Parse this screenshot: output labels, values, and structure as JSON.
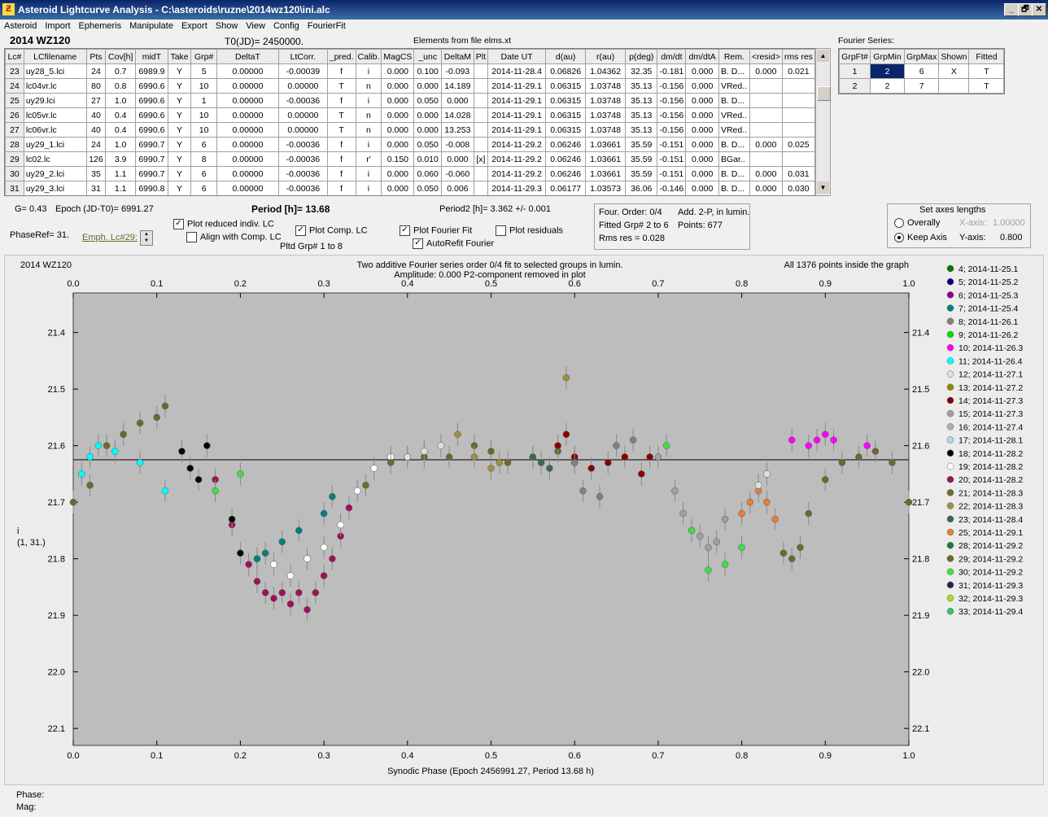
{
  "window": {
    "title": "Asteroid Lightcurve Analysis - C:\\asteroids\\ruzne\\2014wz120\\ini.alc",
    "icon_name": "app-logo-icon",
    "buttons": [
      "_",
      "🗗",
      "✕"
    ]
  },
  "menu": [
    "Asteroid",
    "Import",
    "Ephemeris",
    "Manipulate",
    "Export",
    "Show",
    "View",
    "Config",
    "FourierFit"
  ],
  "header": {
    "asteroid": "2014 WZ120",
    "t0": "T0(JD)= 2450000.",
    "elements": "Elements from file elms.xt"
  },
  "lc_table": {
    "columns": [
      "Lc#",
      "LCfilename",
      "Pts",
      "Cov[h]",
      "midT",
      "Take",
      "Grp#",
      "DeltaT",
      "LtCorr.",
      "_pred.",
      "Calib.",
      "MagCS",
      "_unc",
      "DeltaM",
      "Plt",
      "Date UT",
      "d(au)",
      "r(au)",
      "p(deg)",
      "dm/dt",
      "dm/dtA",
      "Rem.",
      "<resid>",
      "rms res"
    ],
    "rows": [
      [
        "23",
        "uy28_5.lci",
        "24",
        "0.7",
        "6989.9",
        "Y",
        "5",
        "0.00000",
        "-0.00039",
        "f",
        "i",
        "0.000",
        "0.100",
        "-0.093",
        "",
        "2014-11-28.4",
        "0.06826",
        "1.04362",
        "32.35",
        "-0.181",
        "0.000",
        "B. D...",
        "0.000",
        "0.021"
      ],
      [
        "24",
        "lc04vr.lc",
        "80",
        "0.8",
        "6990.6",
        "Y",
        "10",
        "0.00000",
        "0.00000",
        "T",
        "n",
        "0.000",
        "0.000",
        "14.189",
        "",
        "2014-11-29.1",
        "0.06315",
        "1.03748",
        "35.13",
        "-0.156",
        "0.000",
        "VRed..",
        "",
        ""
      ],
      [
        "25",
        "uy29.lci",
        "27",
        "1.0",
        "6990.6",
        "Y",
        "1",
        "0.00000",
        "-0.00036",
        "f",
        "i",
        "0.000",
        "0.050",
        "0.000",
        "",
        "2014-11-29.1",
        "0.06315",
        "1.03748",
        "35.13",
        "-0.156",
        "0.000",
        "B. D...",
        "",
        ""
      ],
      [
        "26",
        "lc05vr.lc",
        "40",
        "0.4",
        "6990.6",
        "Y",
        "10",
        "0.00000",
        "0.00000",
        "T",
        "n",
        "0.000",
        "0.000",
        "14.028",
        "",
        "2014-11-29.1",
        "0.06315",
        "1.03748",
        "35.13",
        "-0.156",
        "0.000",
        "VRed..",
        "",
        ""
      ],
      [
        "27",
        "lc06vr.lc",
        "40",
        "0.4",
        "6990.6",
        "Y",
        "10",
        "0.00000",
        "0.00000",
        "T",
        "n",
        "0.000",
        "0.000",
        "13.253",
        "",
        "2014-11-29.1",
        "0.06315",
        "1.03748",
        "35.13",
        "-0.156",
        "0.000",
        "VRed..",
        "",
        ""
      ],
      [
        "28",
        "uy29_1.lci",
        "24",
        "1.0",
        "6990.7",
        "Y",
        "6",
        "0.00000",
        "-0.00036",
        "f",
        "i",
        "0.000",
        "0.050",
        "-0.008",
        "",
        "2014-11-29.2",
        "0.06246",
        "1.03661",
        "35.59",
        "-0.151",
        "0.000",
        "B. D...",
        "0.000",
        "0.025"
      ],
      [
        "29",
        "lc02.lc",
        "126",
        "3.9",
        "6990.7",
        "Y",
        "8",
        "0.00000",
        "-0.00036",
        "f",
        "r'",
        "0.150",
        "0.010",
        "0.000",
        "[x]",
        "2014-11-29.2",
        "0.06246",
        "1.03661",
        "35.59",
        "-0.151",
        "0.000",
        "BGar..",
        "",
        ""
      ],
      [
        "30",
        "uy29_2.lci",
        "35",
        "1.1",
        "6990.7",
        "Y",
        "6",
        "0.00000",
        "-0.00036",
        "f",
        "i",
        "0.000",
        "0.060",
        "-0.060",
        "",
        "2014-11-29.2",
        "0.06246",
        "1.03661",
        "35.59",
        "-0.151",
        "0.000",
        "B. D...",
        "0.000",
        "0.031"
      ],
      [
        "31",
        "uy29_3.lci",
        "31",
        "1.1",
        "6990.8",
        "Y",
        "6",
        "0.00000",
        "-0.00036",
        "f",
        "i",
        "0.000",
        "0.050",
        "0.006",
        "",
        "2014-11-29.3",
        "0.06177",
        "1.03573",
        "36.06",
        "-0.146",
        "0.000",
        "B. D...",
        "0.000",
        "0.030"
      ]
    ]
  },
  "fourier_table": {
    "title": "Fourier Series:",
    "columns": [
      "GrpFt#",
      "GrpMin",
      "GrpMax",
      "Shown",
      "Fitted"
    ],
    "rows": [
      [
        "1",
        "2",
        "6",
        "X",
        "T"
      ],
      [
        "2",
        "2",
        "7",
        "",
        "T"
      ]
    ]
  },
  "params": {
    "g": "G= 0.43",
    "epoch": "Epoch (JD-T0)= 6991.27",
    "period": "Period [h]= 13.68",
    "period2": "Period2 [h]= 3.362 +/- 0.001",
    "phaseref": "PhaseRef= 31.",
    "emph": "Emph. Lc#29:",
    "pltd_grp": "Pltd Grp#  1   to   8"
  },
  "checkboxes": [
    {
      "label": "Plot reduced indiv. LC",
      "checked": true
    },
    {
      "label": "Align with Comp. LC",
      "checked": false
    },
    {
      "label": "Plot Comp. LC",
      "checked": true
    },
    {
      "label": "Plot Fourier Fit",
      "checked": true
    },
    {
      "label": "AutoRefit Fourier",
      "checked": true
    },
    {
      "label": "Plot residuals",
      "checked": false
    }
  ],
  "fit_info": {
    "order": "Four. Order:  0/4",
    "add": "Add. 2-P, in lumin.",
    "fitted": "Fitted Grp# 2 to 6",
    "points": "Points: 677",
    "rms": "Rms res     = 0.028"
  },
  "axes_box": {
    "title": "Set axes lengths",
    "overally": "Overally",
    "keep": "Keep Axis",
    "xaxis_label": "X-axis:",
    "xaxis_val": "1.00000",
    "yaxis_label": "Y-axis:",
    "yaxis_val": "0.800"
  },
  "status": {
    "phase": "Phase:",
    "mag": "Mag:"
  },
  "chart_data": {
    "type": "scatter",
    "title_left": "2014 WZ120",
    "title_center1": "Two additive Fourier series order 0/4 fit to selected groups in lumin.",
    "title_center2": "Amplitude: 0.000          P2-component removed in plot",
    "title_right": "All 1376 points inside the graph",
    "xlabel": "Synodic Phase (Epoch 2456991.27, Period 13.68 h)",
    "ylabel": "i",
    "ylabel2": "(1, 31.)",
    "xlim": [
      0.0,
      1.0
    ],
    "ylim": [
      22.13,
      21.33
    ],
    "y_inverted": true,
    "xticks": [
      "0.0",
      "0.1",
      "0.2",
      "0.3",
      "0.4",
      "0.5",
      "0.6",
      "0.7",
      "0.8",
      "0.9",
      "1.0"
    ],
    "yticks": [
      "21.4",
      "21.5",
      "21.6",
      "21.7",
      "21.8",
      "21.9",
      "22.0",
      "22.1"
    ],
    "fit_line_mag": 21.625,
    "legend": [
      {
        "label": "4; 2014-11-25.1",
        "color": "#007a00"
      },
      {
        "label": "5; 2014-11-25.2",
        "color": "#00008b"
      },
      {
        "label": "6; 2014-11-25.3",
        "color": "#8b008b"
      },
      {
        "label": "7; 2014-11-25.4",
        "color": "#008080"
      },
      {
        "label": "8; 2014-11-26.1",
        "color": "#808080"
      },
      {
        "label": "9; 2014-11-26.2",
        "color": "#00e000"
      },
      {
        "label": "10; 2014-11-26.3",
        "color": "#ff00ff"
      },
      {
        "label": "11; 2014-11-26.4",
        "color": "#00ffff"
      },
      {
        "label": "12; 2014-11-27.1",
        "color": "#e0e0e0"
      },
      {
        "label": "13; 2014-11-27.2",
        "color": "#8b8b00"
      },
      {
        "label": "14; 2014-11-27.3",
        "color": "#8b0000"
      },
      {
        "label": "15; 2014-11-27.3",
        "color": "#a0a0a0"
      },
      {
        "label": "16; 2014-11-27.4",
        "color": "#b0b0b0"
      },
      {
        "label": "17; 2014-11-28.1",
        "color": "#add8e6"
      },
      {
        "label": "18; 2014-11-28.2",
        "color": "#000000"
      },
      {
        "label": "19; 2014-11-28.2",
        "color": "#ffffff"
      },
      {
        "label": "20; 2014-11-28.2",
        "color": "#a0105a"
      },
      {
        "label": "21; 2014-11-28.3",
        "color": "#6b6b2a"
      },
      {
        "label": "22; 2014-11-28.3",
        "color": "#a09040"
      },
      {
        "label": "23; 2014-11-28.4",
        "color": "#3a6a4a"
      },
      {
        "label": "25; 2014-11-29.1",
        "color": "#e8803a"
      },
      {
        "label": "28; 2014-11-29.2",
        "color": "#1e7a40"
      },
      {
        "label": "29; 2014-11-29.2",
        "color": "#6b6b2a"
      },
      {
        "label": "30; 2014-11-29.2",
        "color": "#40e040"
      },
      {
        "label": "31; 2014-11-29.3",
        "color": "#1a2a4a"
      },
      {
        "label": "32; 2014-11-29.3",
        "color": "#a0e020"
      },
      {
        "label": "33; 2014-11-29.4",
        "color": "#40c060"
      }
    ],
    "series": [
      {
        "name": "20; 2014-11-28.2",
        "color": "#a0105a",
        "x": [
          0.17,
          0.19,
          0.21,
          0.22,
          0.23,
          0.24,
          0.25,
          0.26,
          0.27,
          0.28,
          0.29,
          0.3,
          0.31,
          0.32,
          0.33
        ],
        "y": [
          21.66,
          21.74,
          21.81,
          21.84,
          21.86,
          21.87,
          21.86,
          21.88,
          21.86,
          21.89,
          21.86,
          21.83,
          21.8,
          21.76,
          21.71
        ]
      },
      {
        "name": "19; 2014-11-28.2",
        "color": "#ffffff",
        "x": [
          0.22,
          0.24,
          0.26,
          0.28,
          0.3,
          0.32,
          0.34,
          0.36,
          0.38
        ],
        "y": [
          21.8,
          21.81,
          21.83,
          21.8,
          21.78,
          21.74,
          21.68,
          21.64,
          21.62
        ]
      },
      {
        "name": "7; 2014-11-25.4",
        "color": "#008080",
        "x": [
          0.22,
          0.23,
          0.25,
          0.27,
          0.3,
          0.31
        ],
        "y": [
          21.8,
          21.79,
          21.77,
          21.75,
          21.72,
          21.69
        ]
      },
      {
        "name": "29; 2014-11-29.2",
        "color": "#6b6b2a",
        "x": [
          0.0,
          0.02,
          0.04,
          0.06,
          0.08,
          0.1,
          0.11,
          0.35,
          0.38,
          0.4,
          0.42,
          0.45,
          0.48,
          0.5,
          0.52,
          0.55,
          0.58,
          0.6,
          0.85,
          0.86,
          0.87,
          0.88,
          0.9,
          0.92,
          0.94,
          0.96,
          0.98,
          1.0
        ],
        "y": [
          21.7,
          21.67,
          21.6,
          21.58,
          21.56,
          21.55,
          21.53,
          21.67,
          21.63,
          21.62,
          21.62,
          21.62,
          21.6,
          21.61,
          21.63,
          21.62,
          21.61,
          21.62,
          21.79,
          21.8,
          21.78,
          21.72,
          21.66,
          21.63,
          21.62,
          21.61,
          21.63,
          21.7
        ]
      },
      {
        "name": "14; 2014-11-27.3",
        "color": "#8b0000",
        "x": [
          0.58,
          0.59,
          0.6,
          0.62,
          0.64,
          0.66,
          0.68,
          0.69
        ],
        "y": [
          21.6,
          21.58,
          21.62,
          21.64,
          21.63,
          21.62,
          21.65,
          21.62
        ]
      },
      {
        "name": "15; 2014-11-27.3",
        "color": "#a0a0a0",
        "x": [
          0.7,
          0.72,
          0.73,
          0.74,
          0.75,
          0.76,
          0.77,
          0.78
        ],
        "y": [
          21.62,
          21.68,
          21.72,
          21.75,
          21.76,
          21.78,
          21.77,
          21.73
        ]
      },
      {
        "name": "25; 2014-11-29.1",
        "color": "#e8803a",
        "x": [
          0.8,
          0.81,
          0.82,
          0.83,
          0.84
        ],
        "y": [
          21.72,
          21.7,
          21.68,
          21.7,
          21.73
        ]
      },
      {
        "name": "10; 2014-11-26.3",
        "color": "#ff00ff",
        "x": [
          0.86,
          0.88,
          0.89,
          0.9,
          0.91,
          0.95
        ],
        "y": [
          21.59,
          21.6,
          21.59,
          21.58,
          21.59,
          21.6
        ]
      },
      {
        "name": "11; 2014-11-26.4",
        "color": "#00ffff",
        "x": [
          0.01,
          0.02,
          0.03,
          0.05,
          0.08,
          0.11
        ],
        "y": [
          21.65,
          21.62,
          21.6,
          21.61,
          21.63,
          21.68
        ]
      },
      {
        "name": "18; 2014-11-28.2",
        "color": "#000000",
        "x": [
          0.13,
          0.14,
          0.15,
          0.16,
          0.19,
          0.2
        ],
        "y": [
          21.61,
          21.64,
          21.66,
          21.6,
          21.73,
          21.79
        ]
      },
      {
        "name": "30; 2014-11-29.2",
        "color": "#40e040",
        "x": [
          0.17,
          0.2,
          0.71,
          0.74,
          0.76,
          0.78,
          0.8
        ],
        "y": [
          21.68,
          21.65,
          21.6,
          21.75,
          21.82,
          21.81,
          21.78
        ]
      },
      {
        "name": "8; 2014-11-26.1",
        "color": "#808080",
        "x": [
          0.6,
          0.61,
          0.63,
          0.65,
          0.67
        ],
        "y": [
          21.63,
          21.68,
          21.69,
          21.6,
          21.59
        ]
      },
      {
        "name": "12; 2014-11-27.1",
        "color": "#e0e0e0",
        "x": [
          0.4,
          0.42,
          0.44,
          0.82,
          0.83
        ],
        "y": [
          21.62,
          21.61,
          21.6,
          21.67,
          21.65
        ]
      },
      {
        "name": "23; 2014-11-28.4",
        "color": "#3a6a4a",
        "x": [
          0.55,
          0.56,
          0.57
        ],
        "y": [
          21.62,
          21.63,
          21.64
        ]
      },
      {
        "name": "22; 2014-11-28.3",
        "color": "#a09040",
        "x": [
          0.46,
          0.48,
          0.5,
          0.51,
          0.59
        ],
        "y": [
          21.58,
          21.62,
          21.64,
          21.63,
          21.48
        ]
      }
    ]
  }
}
